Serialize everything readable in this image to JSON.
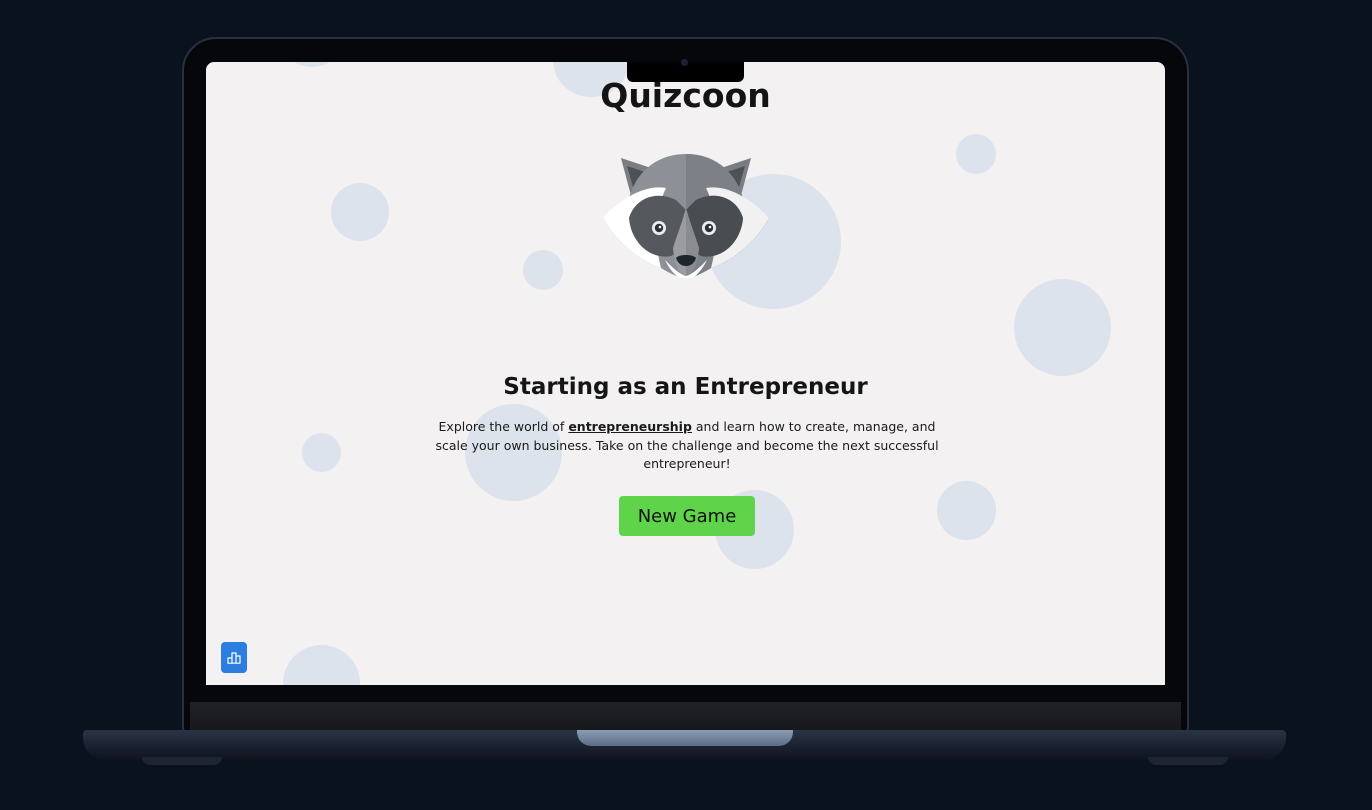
{
  "app": {
    "title": "Quizcoon"
  },
  "quiz": {
    "heading": "Starting as an Entrepreneur",
    "description_before": "Explore the world of ",
    "description_highlight": "entrepreneurship",
    "description_after": " and learn how to create, manage, and scale your own business. Take on the challenge and become the next successful entrepreneur!",
    "start_button_label": "New Game"
  },
  "icons": {
    "mascot": "raccoon-icon",
    "leaderboard": "leaderboard-icon"
  },
  "colors": {
    "start_button": "#5fd34a",
    "leaderboard_button": "#2b7de0",
    "background": "#f3f1f2",
    "bubble": "#dde3ec"
  }
}
